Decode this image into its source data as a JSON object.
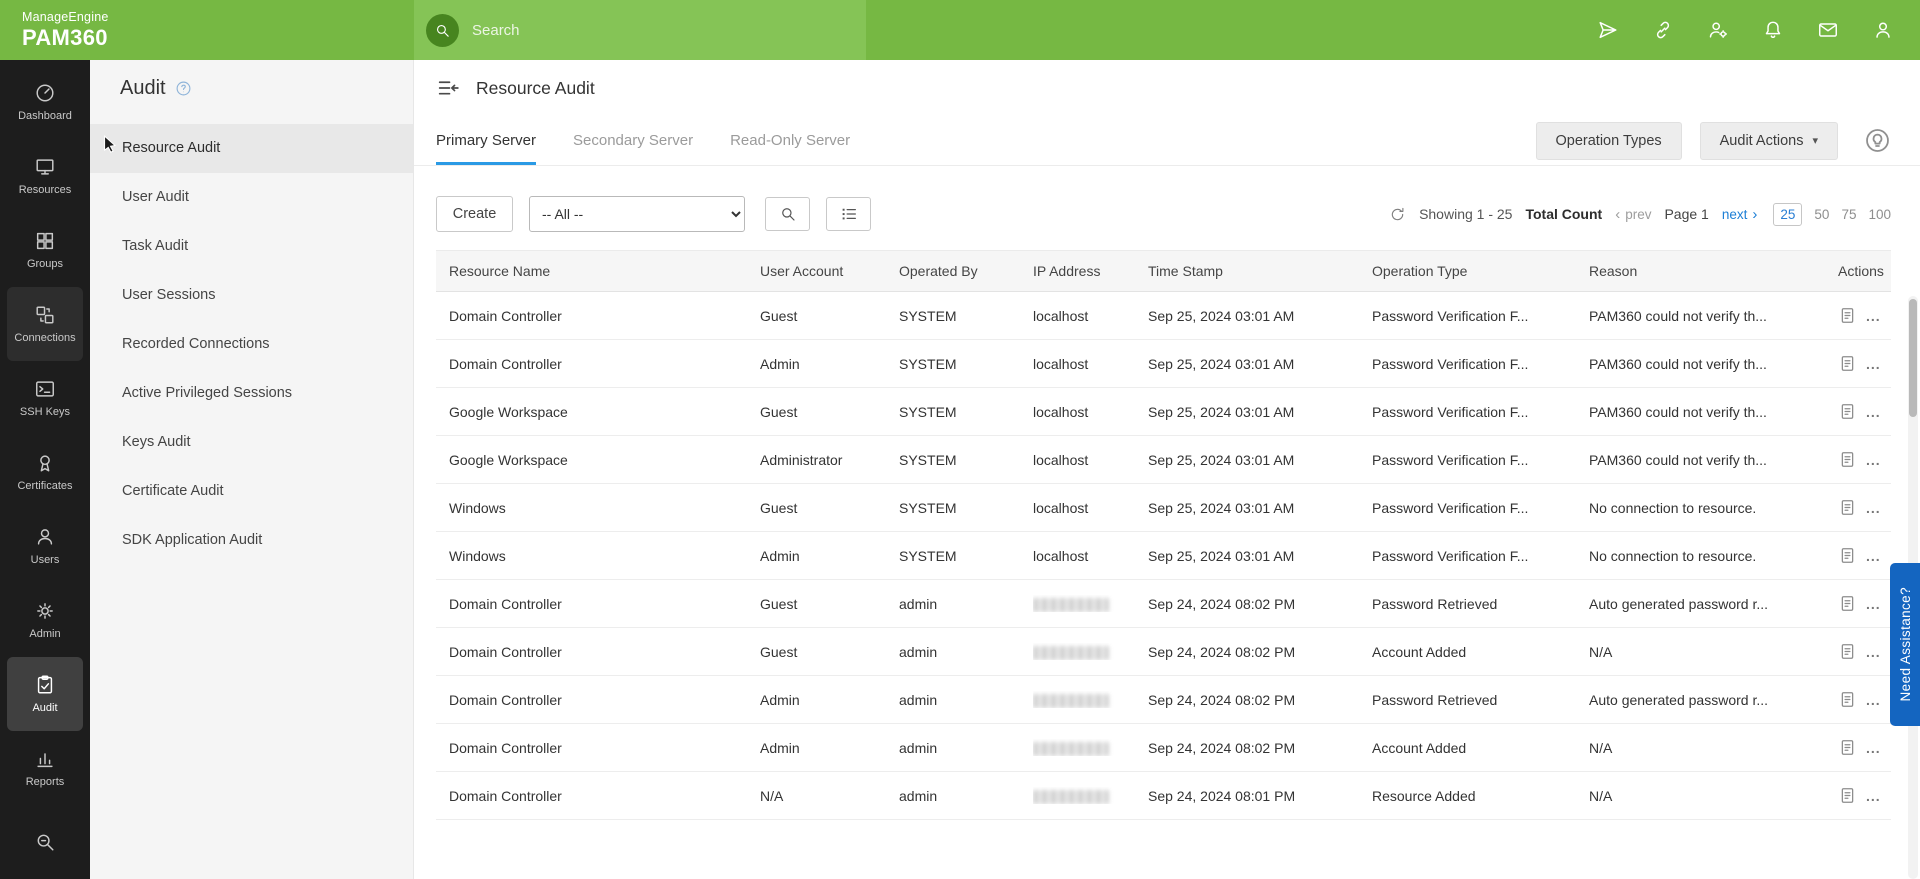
{
  "colors": {
    "brand_green": "#76b843",
    "search_panel_green": "#85c456",
    "accent_blue": "#2a9ae5",
    "link_blue": "#1d7fd6",
    "assist_blue": "#1465c0",
    "sidebar_dark": "#1d1d1d"
  },
  "topbar": {
    "brand_line1": "ManageEngine",
    "brand_line2": "PAM360",
    "search_placeholder": "Search",
    "icons": [
      "launch-icon",
      "link-icon",
      "user-gear-icon",
      "bell-icon",
      "mail-icon",
      "profile-icon"
    ]
  },
  "sidebar": {
    "items": [
      {
        "label": "Dashboard",
        "icon": "dashboard-icon"
      },
      {
        "label": "Resources",
        "icon": "resources-icon"
      },
      {
        "label": "Groups",
        "icon": "groups-icon"
      },
      {
        "label": "Connections",
        "icon": "connections-icon",
        "highlight": true
      },
      {
        "label": "SSH Keys",
        "icon": "ssh-keys-icon"
      },
      {
        "label": "Certificates",
        "icon": "certificates-icon"
      },
      {
        "label": "Users",
        "icon": "users-icon"
      },
      {
        "label": "Admin",
        "icon": "admin-icon"
      },
      {
        "label": "Audit",
        "icon": "audit-icon",
        "selected": true
      },
      {
        "label": "Reports",
        "icon": "reports-icon"
      },
      {
        "label": "",
        "icon": "explore-icon"
      }
    ]
  },
  "audit_nav": {
    "title": "Audit",
    "help_icon": "help-icon",
    "items": [
      {
        "label": "Resource Audit",
        "selected": true
      },
      {
        "label": "User Audit"
      },
      {
        "label": "Task Audit"
      },
      {
        "label": "User Sessions"
      },
      {
        "label": "Recorded Connections"
      },
      {
        "label": "Active Privileged Sessions"
      },
      {
        "label": "Keys Audit"
      },
      {
        "label": "Certificate Audit"
      },
      {
        "label": "SDK Application Audit"
      }
    ]
  },
  "main": {
    "title": "Resource Audit",
    "tabs": [
      {
        "label": "Primary Server",
        "active": true
      },
      {
        "label": "Secondary Server"
      },
      {
        "label": "Read-Only Server"
      }
    ],
    "buttons": {
      "operation_types": "Operation Types",
      "audit_actions": "Audit Actions"
    },
    "toolbar": {
      "create": "Create",
      "filter_value": "-- All --"
    },
    "pagination": {
      "showing": "Showing 1 - 25",
      "total_count": "Total Count",
      "prev": "prev",
      "page": "Page 1",
      "next": "next",
      "page_sizes": [
        {
          "label": "25",
          "selected": true
        },
        {
          "label": "50"
        },
        {
          "label": "75"
        },
        {
          "label": "100"
        }
      ]
    },
    "table": {
      "columns": [
        "Resource Name",
        "User Account",
        "Operated By",
        "IP Address",
        "Time Stamp",
        "Operation Type",
        "Reason",
        "Actions"
      ],
      "rows": [
        {
          "resource": "Domain Controller",
          "account": "Guest",
          "operated_by": "SYSTEM",
          "ip": "localhost",
          "time": "Sep 25, 2024 03:01 AM",
          "operation": "Password Verification F...",
          "reason": "PAM360 could not verify th..."
        },
        {
          "resource": "Domain Controller",
          "account": "Admin",
          "operated_by": "SYSTEM",
          "ip": "localhost",
          "time": "Sep 25, 2024 03:01 AM",
          "operation": "Password Verification F...",
          "reason": "PAM360 could not verify th..."
        },
        {
          "resource": "Google Workspace",
          "account": "Guest",
          "operated_by": "SYSTEM",
          "ip": "localhost",
          "time": "Sep 25, 2024 03:01 AM",
          "operation": "Password Verification F...",
          "reason": "PAM360 could not verify th..."
        },
        {
          "resource": "Google Workspace",
          "account": "Administrator",
          "operated_by": "SYSTEM",
          "ip": "localhost",
          "time": "Sep 25, 2024 03:01 AM",
          "operation": "Password Verification F...",
          "reason": "PAM360 could not verify th..."
        },
        {
          "resource": "Windows",
          "account": "Guest",
          "operated_by": "SYSTEM",
          "ip": "localhost",
          "time": "Sep 25, 2024 03:01 AM",
          "operation": "Password Verification F...",
          "reason": "No connection to resource."
        },
        {
          "resource": "Windows",
          "account": "Admin",
          "operated_by": "SYSTEM",
          "ip": "localhost",
          "time": "Sep 25, 2024 03:01 AM",
          "operation": "Password Verification F...",
          "reason": "No connection to resource."
        },
        {
          "resource": "Domain Controller",
          "account": "Guest",
          "operated_by": "admin",
          "ip_redacted": true,
          "time": "Sep 24, 2024 08:02 PM",
          "operation": "Password Retrieved",
          "reason": "Auto generated password r..."
        },
        {
          "resource": "Domain Controller",
          "account": "Guest",
          "operated_by": "admin",
          "ip_redacted": true,
          "time": "Sep 24, 2024 08:02 PM",
          "operation": "Account Added",
          "reason": "N/A"
        },
        {
          "resource": "Domain Controller",
          "account": "Admin",
          "operated_by": "admin",
          "ip_redacted": true,
          "time": "Sep 24, 2024 08:02 PM",
          "operation": "Password Retrieved",
          "reason": "Auto generated password r..."
        },
        {
          "resource": "Domain Controller",
          "account": "Admin",
          "operated_by": "admin",
          "ip_redacted": true,
          "time": "Sep 24, 2024 08:02 PM",
          "operation": "Account Added",
          "reason": "N/A"
        },
        {
          "resource": "Domain Controller",
          "account": "N/A",
          "operated_by": "admin",
          "ip_redacted": true,
          "time": "Sep 24, 2024 08:01 PM",
          "operation": "Resource Added",
          "reason": "N/A"
        }
      ]
    }
  },
  "assist_tab": "Need Assistance?"
}
